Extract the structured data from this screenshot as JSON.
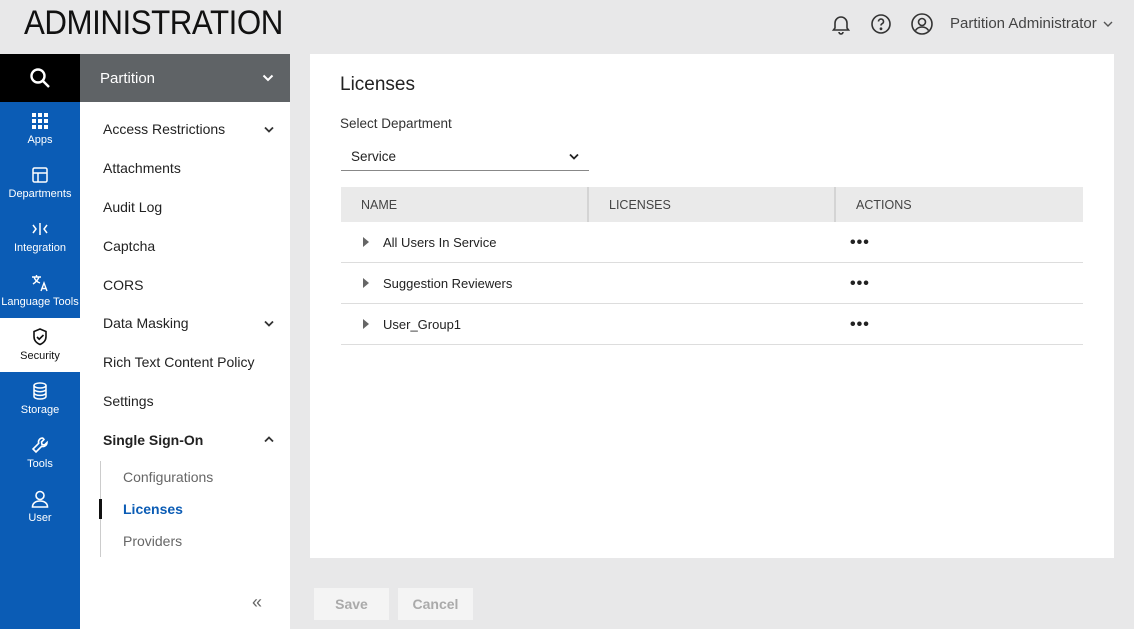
{
  "app": {
    "title": "ADMINISTRATION"
  },
  "header": {
    "user": "Partition Administrator"
  },
  "rail": {
    "items": [
      {
        "label": "Apps",
        "icon": "grid-icon"
      },
      {
        "label": "Departments",
        "icon": "departments-icon"
      },
      {
        "label": "Integration",
        "icon": "integration-icon"
      },
      {
        "label": "Language Tools",
        "icon": "translate-icon"
      },
      {
        "label": "Security",
        "icon": "shield-icon"
      },
      {
        "label": "Storage",
        "icon": "database-icon"
      },
      {
        "label": "Tools",
        "icon": "wrench-icon"
      },
      {
        "label": "User",
        "icon": "user-icon"
      }
    ],
    "active": "Security"
  },
  "subnav": {
    "title": "Partition",
    "items": [
      {
        "label": "Access Restrictions"
      },
      {
        "label": "Attachments"
      },
      {
        "label": "Audit Log"
      },
      {
        "label": "Captcha"
      },
      {
        "label": "CORS"
      },
      {
        "label": "Data Masking"
      },
      {
        "label": "Rich Text Content Policy"
      },
      {
        "label": "Settings"
      },
      {
        "label": "Single Sign-On"
      }
    ],
    "sso_children": [
      {
        "label": "Configurations"
      },
      {
        "label": "Licenses"
      },
      {
        "label": "Providers"
      }
    ]
  },
  "main": {
    "title": "Licenses",
    "dept_label": "Select Department",
    "dept_value": "Service",
    "columns": [
      "NAME",
      "LICENSES",
      "ACTIONS"
    ],
    "rows": [
      {
        "name": "All Users In Service",
        "licenses": "",
        "actions": "•••"
      },
      {
        "name": "Suggestion Reviewers",
        "licenses": "",
        "actions": "•••"
      },
      {
        "name": "User_Group1",
        "licenses": "",
        "actions": "•••"
      }
    ]
  },
  "footer": {
    "save": "Save",
    "cancel": "Cancel"
  },
  "colors": {
    "accent": "#0b5cb5",
    "rail_search": "#000000",
    "subnav_head": "#5f6366"
  }
}
